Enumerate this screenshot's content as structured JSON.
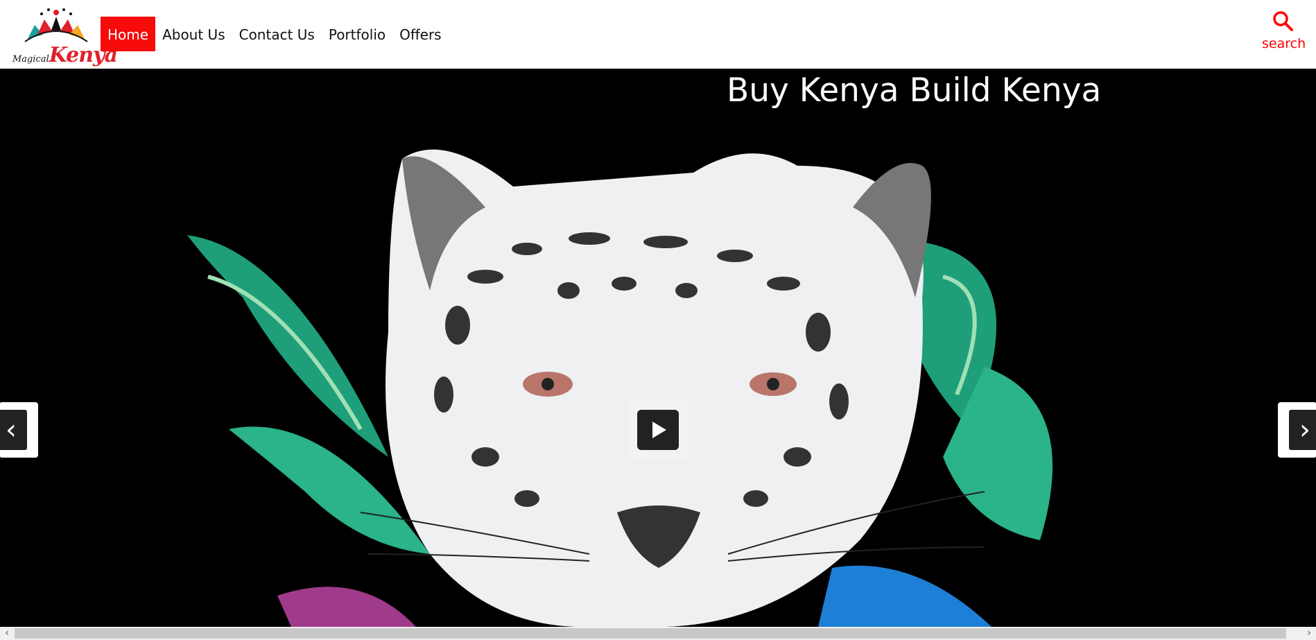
{
  "brand": {
    "magical": "Magical",
    "kenya": "Kenya"
  },
  "nav": [
    {
      "label": "Home",
      "active": true
    },
    {
      "label": "About Us"
    },
    {
      "label": "Contact Us"
    },
    {
      "label": "Portfolio"
    },
    {
      "label": "Offers"
    }
  ],
  "search": {
    "label": "search",
    "icon": "search-icon"
  },
  "hero": {
    "title": "Buy Kenya Build Kenya"
  },
  "slider": {
    "prev_icon": "chevron-left-icon",
    "next_icon": "chevron-right-icon",
    "play_icon": "play-icon"
  },
  "scrollbar": {
    "left": "‹",
    "right": "›"
  },
  "colors": {
    "accent": "#f70b0b",
    "hero_bg": "#000000"
  }
}
